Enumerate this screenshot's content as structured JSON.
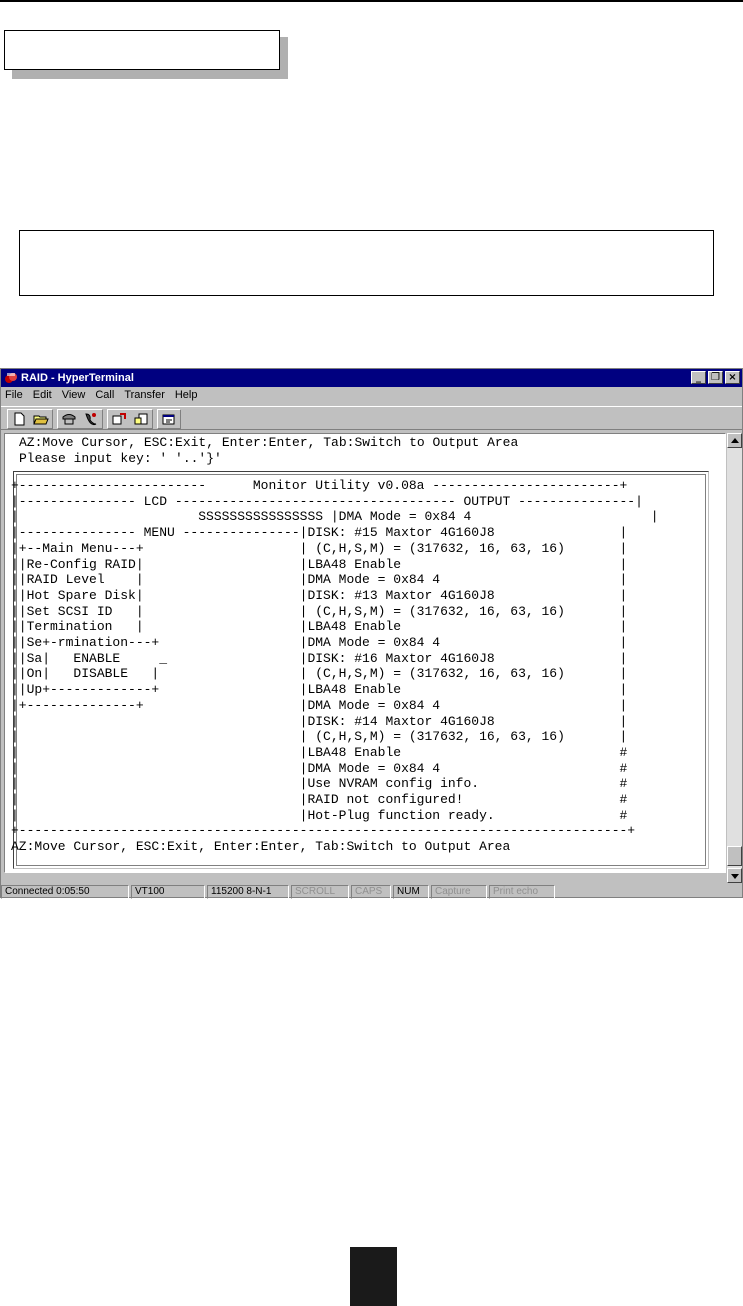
{
  "window": {
    "title": "RAID - HyperTerminal",
    "buttons": [
      "_",
      "❐",
      "×"
    ]
  },
  "menu": [
    "File",
    "Edit",
    "View",
    "Call",
    "Transfer",
    "Help"
  ],
  "terminal": {
    "top_line1": "AZ:Move Cursor, ESC:Exit, Enter:Enter, Tab:Switch to Output Area",
    "top_line2": "Please input key: ' '..'}'"
  },
  "screen_lines": [
    "+------------------------      Monitor Utility v0.08a ------------------------+",
    "|--------------- LCD ------------------------------------ OUTPUT ---------------|",
    "|                       SSSSSSSSSSSSSSSS |DMA Mode = 0x84 4                       |",
    "|--------------- MENU ---------------|DISK: #15 Maxtor 4G160J8                |",
    "|+--Main Menu---+                    | (C,H,S,M) = (317632, 16, 63, 16)       |",
    "||Re-Config RAID|                    |LBA48 Enable                            |",
    "||RAID Level    |                    |DMA Mode = 0x84 4                       |",
    "||Hot Spare Disk|                    |DISK: #13 Maxtor 4G160J8                |",
    "||Set SCSI ID   |                    | (C,H,S,M) = (317632, 16, 63, 16)       |",
    "||Termination   |                    |LBA48 Enable                            |",
    "||Se+-rmination---+                  |DMA Mode = 0x84 4                       |",
    "||Sa|   ENABLE     _                 |DISK: #16 Maxtor 4G160J8                |",
    "||On|   DISABLE   |                  | (C,H,S,M) = (317632, 16, 63, 16)       |",
    "||Up+-------------+                  |LBA48 Enable                            |",
    "|+--------------+                    |DMA Mode = 0x84 4                       |",
    "|                                    |DISK: #14 Maxtor 4G160J8                |",
    "|                                    | (C,H,S,M) = (317632, 16, 63, 16)       |",
    "|                                    |LBA48 Enable                            #",
    "|                                    |DMA Mode = 0x84 4                       #",
    "|                                    |Use NVRAM config info.                  #",
    "|                                    |RAID not configured!                    #",
    "|                                    |Hot-Plug function ready.                #",
    "+------------------------------------------------------------------------------+",
    "AZ:Move Cursor, ESC:Exit, Enter:Enter, Tab:Switch to Output Area"
  ],
  "status": [
    {
      "label": "Connected 0:05:50",
      "active": true
    },
    {
      "label": "VT100",
      "active": true
    },
    {
      "label": "115200 8-N-1",
      "active": true
    },
    {
      "label": "SCROLL",
      "active": false
    },
    {
      "label": "CAPS",
      "active": false
    },
    {
      "label": "NUM",
      "active": true
    },
    {
      "label": "Capture",
      "active": false
    },
    {
      "label": "Print echo",
      "active": false
    }
  ],
  "icons": {
    "toolbar": [
      "new-icon",
      "open-icon",
      "connect-icon",
      "disconnect-icon",
      "send-icon",
      "receive-icon",
      "properties-icon"
    ]
  }
}
